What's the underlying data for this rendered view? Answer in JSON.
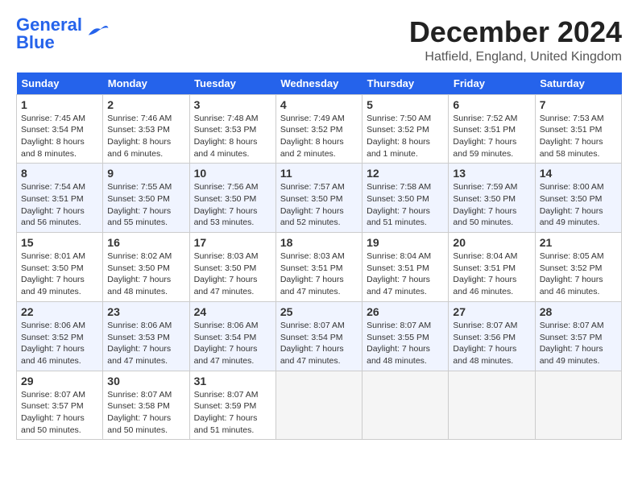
{
  "logo": {
    "line1": "General",
    "line2": "Blue"
  },
  "title": "December 2024",
  "subtitle": "Hatfield, England, United Kingdom",
  "headers": [
    "Sunday",
    "Monday",
    "Tuesday",
    "Wednesday",
    "Thursday",
    "Friday",
    "Saturday"
  ],
  "weeks": [
    [
      {
        "day": "1",
        "sunrise": "7:45 AM",
        "sunset": "3:54 PM",
        "daylight": "8 hours and 8 minutes."
      },
      {
        "day": "2",
        "sunrise": "7:46 AM",
        "sunset": "3:53 PM",
        "daylight": "8 hours and 6 minutes."
      },
      {
        "day": "3",
        "sunrise": "7:48 AM",
        "sunset": "3:53 PM",
        "daylight": "8 hours and 4 minutes."
      },
      {
        "day": "4",
        "sunrise": "7:49 AM",
        "sunset": "3:52 PM",
        "daylight": "8 hours and 2 minutes."
      },
      {
        "day": "5",
        "sunrise": "7:50 AM",
        "sunset": "3:52 PM",
        "daylight": "8 hours and 1 minute."
      },
      {
        "day": "6",
        "sunrise": "7:52 AM",
        "sunset": "3:51 PM",
        "daylight": "7 hours and 59 minutes."
      },
      {
        "day": "7",
        "sunrise": "7:53 AM",
        "sunset": "3:51 PM",
        "daylight": "7 hours and 58 minutes."
      }
    ],
    [
      {
        "day": "8",
        "sunrise": "7:54 AM",
        "sunset": "3:51 PM",
        "daylight": "7 hours and 56 minutes."
      },
      {
        "day": "9",
        "sunrise": "7:55 AM",
        "sunset": "3:50 PM",
        "daylight": "7 hours and 55 minutes."
      },
      {
        "day": "10",
        "sunrise": "7:56 AM",
        "sunset": "3:50 PM",
        "daylight": "7 hours and 53 minutes."
      },
      {
        "day": "11",
        "sunrise": "7:57 AM",
        "sunset": "3:50 PM",
        "daylight": "7 hours and 52 minutes."
      },
      {
        "day": "12",
        "sunrise": "7:58 AM",
        "sunset": "3:50 PM",
        "daylight": "7 hours and 51 minutes."
      },
      {
        "day": "13",
        "sunrise": "7:59 AM",
        "sunset": "3:50 PM",
        "daylight": "7 hours and 50 minutes."
      },
      {
        "day": "14",
        "sunrise": "8:00 AM",
        "sunset": "3:50 PM",
        "daylight": "7 hours and 49 minutes."
      }
    ],
    [
      {
        "day": "15",
        "sunrise": "8:01 AM",
        "sunset": "3:50 PM",
        "daylight": "7 hours and 49 minutes."
      },
      {
        "day": "16",
        "sunrise": "8:02 AM",
        "sunset": "3:50 PM",
        "daylight": "7 hours and 48 minutes."
      },
      {
        "day": "17",
        "sunrise": "8:03 AM",
        "sunset": "3:50 PM",
        "daylight": "7 hours and 47 minutes."
      },
      {
        "day": "18",
        "sunrise": "8:03 AM",
        "sunset": "3:51 PM",
        "daylight": "7 hours and 47 minutes."
      },
      {
        "day": "19",
        "sunrise": "8:04 AM",
        "sunset": "3:51 PM",
        "daylight": "7 hours and 47 minutes."
      },
      {
        "day": "20",
        "sunrise": "8:04 AM",
        "sunset": "3:51 PM",
        "daylight": "7 hours and 46 minutes."
      },
      {
        "day": "21",
        "sunrise": "8:05 AM",
        "sunset": "3:52 PM",
        "daylight": "7 hours and 46 minutes."
      }
    ],
    [
      {
        "day": "22",
        "sunrise": "8:06 AM",
        "sunset": "3:52 PM",
        "daylight": "7 hours and 46 minutes."
      },
      {
        "day": "23",
        "sunrise": "8:06 AM",
        "sunset": "3:53 PM",
        "daylight": "7 hours and 47 minutes."
      },
      {
        "day": "24",
        "sunrise": "8:06 AM",
        "sunset": "3:54 PM",
        "daylight": "7 hours and 47 minutes."
      },
      {
        "day": "25",
        "sunrise": "8:07 AM",
        "sunset": "3:54 PM",
        "daylight": "7 hours and 47 minutes."
      },
      {
        "day": "26",
        "sunrise": "8:07 AM",
        "sunset": "3:55 PM",
        "daylight": "7 hours and 48 minutes."
      },
      {
        "day": "27",
        "sunrise": "8:07 AM",
        "sunset": "3:56 PM",
        "daylight": "7 hours and 48 minutes."
      },
      {
        "day": "28",
        "sunrise": "8:07 AM",
        "sunset": "3:57 PM",
        "daylight": "7 hours and 49 minutes."
      }
    ],
    [
      {
        "day": "29",
        "sunrise": "8:07 AM",
        "sunset": "3:57 PM",
        "daylight": "7 hours and 50 minutes."
      },
      {
        "day": "30",
        "sunrise": "8:07 AM",
        "sunset": "3:58 PM",
        "daylight": "7 hours and 50 minutes."
      },
      {
        "day": "31",
        "sunrise": "8:07 AM",
        "sunset": "3:59 PM",
        "daylight": "7 hours and 51 minutes."
      },
      null,
      null,
      null,
      null
    ]
  ]
}
